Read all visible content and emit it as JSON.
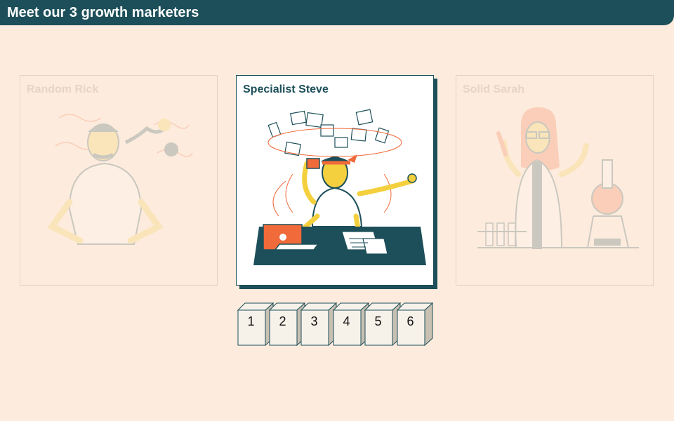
{
  "header": {
    "title": "Meet our 3 growth marketers"
  },
  "cards": [
    {
      "name": "Random Rick",
      "state": "inactive"
    },
    {
      "name": "Specialist Steve",
      "state": "active"
    },
    {
      "name": "Solid Sarah",
      "state": "inactive"
    }
  ],
  "pager": {
    "pages": [
      "1",
      "2",
      "3",
      "4",
      "5",
      "6"
    ]
  },
  "colors": {
    "background": "#fdebdd",
    "header": "#1c4f59",
    "accent_yellow": "#f4d03f",
    "accent_orange": "#f06a3a"
  }
}
